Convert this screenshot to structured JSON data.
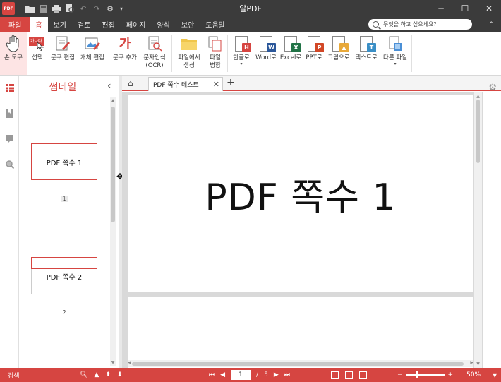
{
  "window": {
    "app_logo": "PDF",
    "title": "알PDF",
    "controls": {
      "minimize": "─",
      "maximize": "☐",
      "close": "✕"
    }
  },
  "quick_access": {
    "icons": [
      "open-folder-icon",
      "save-icon",
      "print-icon",
      "print-preview-icon",
      "undo-icon",
      "redo-icon",
      "settings-icon",
      "dropdown-icon"
    ],
    "glyphs": [
      "📂",
      "💾",
      "🖶",
      "🔍",
      "↶",
      "↷",
      "⚙",
      "▾"
    ]
  },
  "menu": {
    "items": [
      "파일",
      "홈",
      "보기",
      "검토",
      "편집",
      "페이지",
      "양식",
      "보안",
      "도움말"
    ],
    "active": "홈",
    "search_placeholder": "무엇을 하고 싶으세요?",
    "collapse": "⌃"
  },
  "ribbon": {
    "buttons": [
      {
        "label": "손 도구",
        "icon": "hand-tool-icon"
      },
      {
        "label": "선택",
        "icon": "select-icon",
        "badge": "가나다"
      },
      {
        "label": "문구 편집",
        "icon": "text-edit-icon"
      },
      {
        "label": "개체 편집",
        "icon": "object-edit-icon"
      },
      {
        "label": "문구 추가",
        "icon": "add-text-icon",
        "glyph": "가"
      },
      {
        "label": "문자인식",
        "sub": "(OCR)",
        "icon": "ocr-icon"
      },
      {
        "label": "파일에서",
        "sub": "생성",
        "icon": "create-from-file-icon"
      },
      {
        "label": "파일",
        "sub": "병합",
        "icon": "merge-files-icon"
      },
      {
        "label": "한글로",
        "icon": "to-hwp-icon",
        "badge": "H",
        "color": "#d64541",
        "dropdown": true
      },
      {
        "label": "Word로",
        "icon": "to-word-icon",
        "badge": "W",
        "color": "#2b579a"
      },
      {
        "label": "Excel로",
        "icon": "to-excel-icon",
        "badge": "X",
        "color": "#217346"
      },
      {
        "label": "PPT로",
        "icon": "to-ppt-icon",
        "badge": "P",
        "color": "#d24726"
      },
      {
        "label": "그림으로",
        "icon": "to-image-icon",
        "badge": "▲",
        "color": "#e8a93a"
      },
      {
        "label": "텍스트로",
        "icon": "to-text-icon",
        "badge": "T",
        "color": "#3a8fc6"
      },
      {
        "label": "다른 파일",
        "icon": "to-other-file-icon",
        "dropdown": true
      }
    ],
    "active": "손 도구"
  },
  "thumbnails": {
    "title": "썸네일",
    "collapse": "‹",
    "pages": [
      {
        "text": "PDF 쪽수 1",
        "number": "1"
      },
      {
        "text": "PDF 쪽수 2",
        "number": "2"
      }
    ]
  },
  "tabs": {
    "home": "⌂",
    "doc_tab": "PDF 쪽수 테스트",
    "close": "✕",
    "add": "+",
    "settings": "⚙"
  },
  "document": {
    "page1_text": "PDF 쪽수 1"
  },
  "statusbar": {
    "search": "검색",
    "current_page": "1",
    "page_separator": "/",
    "total_pages": "5",
    "zoom": "50%",
    "zoom_minus": "−",
    "zoom_plus": "+",
    "zoom_level": 0.25
  }
}
